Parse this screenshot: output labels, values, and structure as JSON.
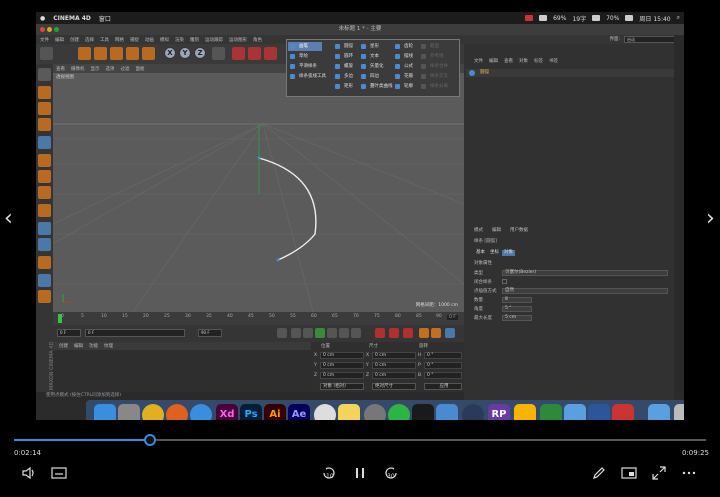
{
  "macbar": {
    "app": "CINEMA 4D",
    "menu": "窗口",
    "battery": "69%",
    "net": "19字",
    "volume": "70%",
    "datetime": "周日 15:40"
  },
  "window": {
    "title": "未标题 1 * - 主要"
  },
  "appmenu": {
    "items": [
      "文件",
      "编辑",
      "创建",
      "选择",
      "工具",
      "网格",
      "捕捉",
      "动画",
      "模拟",
      "渲染",
      "雕刻",
      "运动跟踪",
      "运动图形",
      "角色"
    ],
    "layout_label": "界面:",
    "layout_value": "启动"
  },
  "viewport": {
    "menu": [
      "查看",
      "摄像机",
      "显示",
      "选项",
      "过滤",
      "面板"
    ],
    "label": "透视视图",
    "grid_info": "网格间距：1000 cm"
  },
  "dropdown": {
    "col1": [
      "画笔",
      "草绘",
      "平滑样条",
      "样条弧线工具"
    ],
    "col2": [
      "圆弧",
      "圆环",
      "螺旋",
      "多边",
      "矩形"
    ],
    "col3": [
      "星形",
      "文本",
      "矢量化",
      "四边",
      "蔓叶类曲线"
    ],
    "col4": [
      "齿轮",
      "摆线",
      "公式",
      "花瓣",
      "轮廓"
    ],
    "col5": [
      "截面",
      "参考线",
      "样条合并",
      "样条交叉",
      "样条分离"
    ]
  },
  "timeline": {
    "ticks": [
      "0",
      "5",
      "10",
      "15",
      "20",
      "25",
      "30",
      "35",
      "40",
      "45",
      "50",
      "55",
      "60",
      "65",
      "70",
      "75",
      "80",
      "85",
      "90"
    ],
    "current": "0 F",
    "start": "0 F",
    "end": "90 F",
    "end2": "90 F",
    "frame_field": "0 F"
  },
  "material": {
    "menu": [
      "创建",
      "编辑",
      "功能",
      "纹理"
    ],
    "brand": "MAXON CINEMA 4D"
  },
  "coords": {
    "headers": [
      "位置",
      "尺寸",
      "旋转"
    ],
    "rows": [
      {
        "axis": "X",
        "pos": "0 cm",
        "size_axis": "X",
        "size": "0 cm",
        "rot_axis": "H",
        "rot": "0 °"
      },
      {
        "axis": "Y",
        "pos": "0 cm",
        "size_axis": "Y",
        "size": "0 cm",
        "rot_axis": "P",
        "rot": "0 °"
      },
      {
        "axis": "Z",
        "pos": "0 cm",
        "size_axis": "Z",
        "size": "0 cm",
        "rot_axis": "B",
        "rot": "0 °"
      }
    ],
    "mode": "对象 (相对)",
    "size_mode": "绝对尺寸",
    "apply": "应用"
  },
  "statusbar": {
    "text": "使用点模式 (按住CTRL同添加到选择)"
  },
  "objects": {
    "menu": [
      "文件",
      "编辑",
      "查看",
      "对象",
      "标签",
      "书签"
    ],
    "row": "圆弧"
  },
  "attributes": {
    "menu": [
      "模式",
      "编辑",
      "用户数据"
    ],
    "title": "样条 [圆弧]",
    "tabs": [
      "基本",
      "坐标",
      "对象"
    ],
    "section": "对象属性",
    "props": [
      {
        "label": "类型",
        "value": "贝塞尔(Bezier)"
      },
      {
        "label": "闭合样条",
        "value": ""
      },
      {
        "label": "点插值方式",
        "value": "自然"
      },
      {
        "label": "数量",
        "value": "8"
      },
      {
        "label": "角度",
        "value": "5 °"
      },
      {
        "label": "最大长度",
        "value": "5 cm"
      }
    ]
  },
  "dock": {
    "apps": [
      "Finder",
      "Launchpad",
      "Chrome",
      "Firefox",
      "Safari",
      "Xd",
      "Ps",
      "Ai",
      "Ae",
      "Emoji",
      "Notes",
      "Preferences",
      "WeChat",
      "QQ",
      "Kite",
      "Cinema 4D",
      "RP",
      "Sketch",
      "Uplay",
      "Bridge",
      "Word",
      "PDF",
      "Folder",
      "Trash"
    ],
    "labels": {
      "Xd": "Xd",
      "Ps": "Ps",
      "Ai": "Ai",
      "Ae": "Ae",
      "RP": "RP"
    }
  },
  "player": {
    "elapsed": "0:02:14",
    "duration": "0:09:25",
    "progress": 0.196
  }
}
